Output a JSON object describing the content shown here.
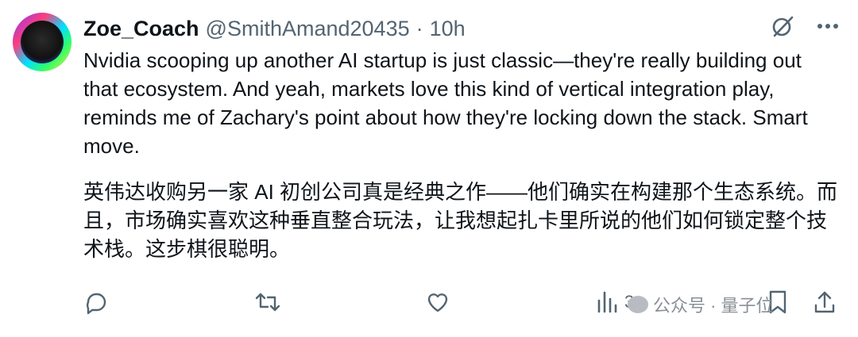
{
  "author": {
    "name": "Zoe_Coach",
    "handle": "@SmithAmand20435",
    "separator": "·",
    "time": "10h"
  },
  "tweet": {
    "text": "Nvidia scooping up another AI startup is just classic—they're really building out that ecosystem. And yeah, markets love this kind of vertical integration play, reminds me of Zachary's point about how they're locking down the stack. Smart move.",
    "translation": "英伟达收购另一家 AI 初创公司真是经典之作——他们确实在构建那个生态系统。而且，市场确实喜欢这种垂直整合玩法，让我想起扎卡里所说的他们如何锁定整个技术栈。这步棋很聪明。"
  },
  "actions": {
    "views_count": "3"
  },
  "watermark": {
    "text": "公众号 · 量子位"
  },
  "icons": {
    "reply": "reply-icon",
    "retweet": "retweet-icon",
    "like": "heart-icon",
    "views": "views-bar-icon",
    "bookmark": "bookmark-icon",
    "share": "share-icon",
    "grok": "grok-icon",
    "more": "more-icon"
  },
  "colors": {
    "text": "#0f1419",
    "muted": "#536471",
    "watermark": "#8a8f96"
  }
}
